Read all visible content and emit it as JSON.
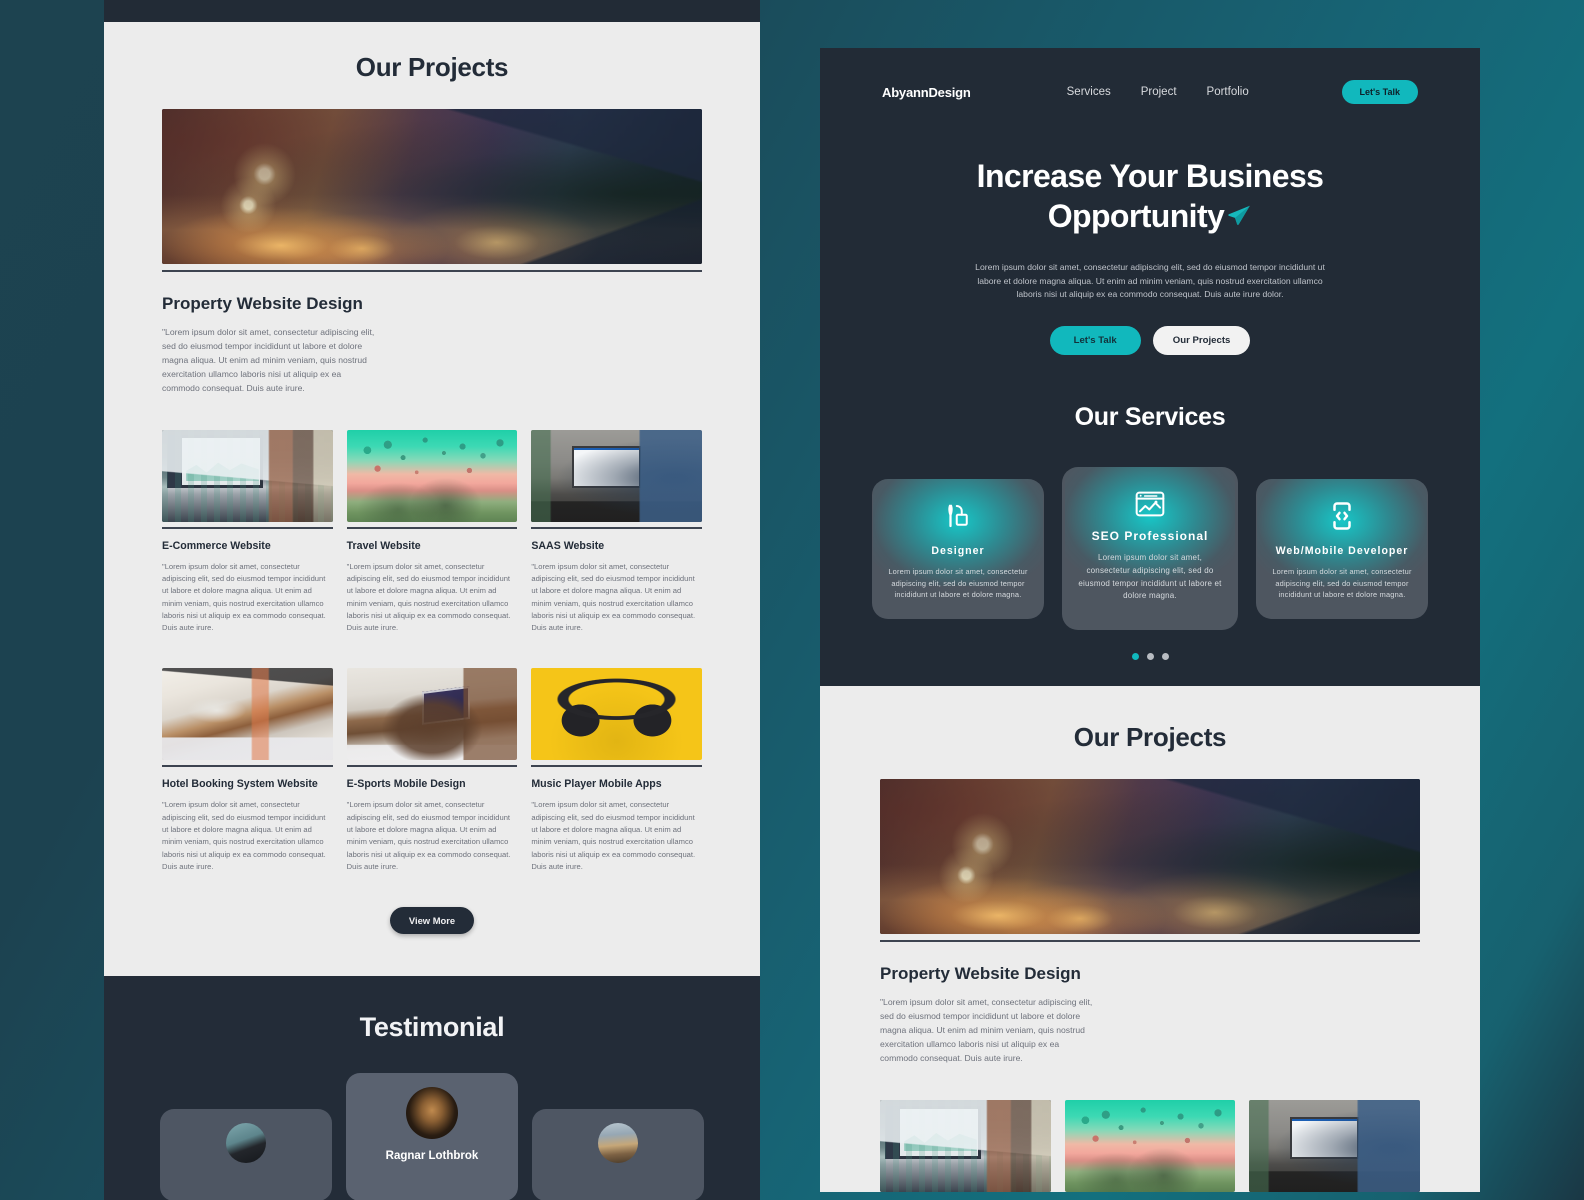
{
  "colors": {
    "teal_accent": "#11b8bd",
    "dark_navy": "#222b36",
    "light_bg": "#ececec",
    "page_bg_left": "#1d4350",
    "page_bg_right": "#13707e"
  },
  "left_mockup": {
    "projects_title": "Our Projects",
    "featured": {
      "image_alt": "modern-house-at-dusk-photo",
      "title": "Property Website Design",
      "body": "\"Lorem ipsum dolor sit amet, consectetur adipiscing elit, sed do eiusmod tempor incididunt ut labore et dolore magna aliqua. Ut enim ad minim veniam, quis nostrud exercitation ullamco laboris nisi ut aliquip ex ea commodo consequat. Duis aute irure."
    },
    "project_body": "\"Lorem ipsum dolor sit amet, consectetur adipiscing elit, sed do eiusmod tempor incididunt ut labore et dolore magna aliqua. Ut enim ad minim veniam, quis nostrud exercitation ullamco laboris nisi ut aliquip ex ea commodo consequat. Duis aute irure.",
    "projects_row1": [
      {
        "title": "E-Commerce Website",
        "image_alt": "laptop-dashboard-photo"
      },
      {
        "title": "Travel Website",
        "image_alt": "hot-air-balloons-photo"
      },
      {
        "title": "SAAS Website",
        "image_alt": "man-at-imac-photo"
      }
    ],
    "projects_row2": [
      {
        "title": "Hotel Booking System Website",
        "image_alt": "hotel-nightstand-photo"
      },
      {
        "title": "E-Sports Mobile Design",
        "image_alt": "laptop-on-bed-tray-photo"
      },
      {
        "title": "Music Player Mobile Apps",
        "image_alt": "yellow-headphones-photo"
      }
    ],
    "view_more_label": "View More",
    "testimonial_title": "Testimonial",
    "testimonials": [
      {
        "name": "",
        "avatar_alt": "person-in-beanie-avatar"
      },
      {
        "name": "Ragnar Lothbrok",
        "avatar_alt": "viking-warrior-avatar"
      },
      {
        "name": "",
        "avatar_alt": "mountain-landscape-avatar"
      }
    ]
  },
  "right_mockup": {
    "nav": {
      "brand": "AbyannDesign",
      "links": [
        "Services",
        "Project",
        "Portfolio"
      ],
      "cta_label": "Let's Talk"
    },
    "hero": {
      "heading_line1": "Increase Your Business",
      "heading_line2": "Opportunity",
      "paragraph": "Lorem ipsum dolor sit amet, consectetur adipiscing elit, sed do eiusmod tempor incididunt ut labore et dolore magna aliqua. Ut enim ad minim veniam, quis nostrud exercitation ullamco laboris nisi ut aliquip ex ea commodo consequat. Duis aute irure dolor.",
      "primary_btn": "Let's Talk",
      "secondary_btn": "Our Projects",
      "paper_plane_icon": "paper-plane-icon"
    },
    "services": {
      "title": "Our Services",
      "cards": [
        {
          "name": "Designer",
          "icon": "pen-and-shape-icon",
          "desc": "Lorem ipsum dolor sit amet, consectetur adipiscing elit, sed do eiusmod tempor incididunt ut labore et dolore magna."
        },
        {
          "name": "SEO Professional",
          "icon": "browser-chart-icon",
          "desc": "Lorem ipsum dolor sit amet, consectetur adipiscing elit, sed do eiusmod tempor incididunt ut labore et dolore magna."
        },
        {
          "name": "Web/Mobile Developer",
          "icon": "mobile-code-icon",
          "desc": "Lorem ipsum dolor sit amet, consectetur adipiscing elit, sed do eiusmod tempor incididunt ut labore et dolore magna."
        }
      ],
      "carousel_dots": 3,
      "active_dot": 0
    },
    "projects": {
      "title": "Our Projects",
      "featured_title": "Property Website Design",
      "featured_body": "\"Lorem ipsum dolor sit amet, consectetur adipiscing elit, sed do eiusmod tempor incididunt ut labore et dolore magna aliqua. Ut enim ad minim veniam, quis nostrud exercitation ullamco laboris nisi ut aliquip ex ea commodo consequat. Duis aute irure.",
      "thumbs": [
        "laptop-dashboard-photo",
        "hot-air-balloons-photo",
        "man-at-imac-photo"
      ]
    }
  }
}
